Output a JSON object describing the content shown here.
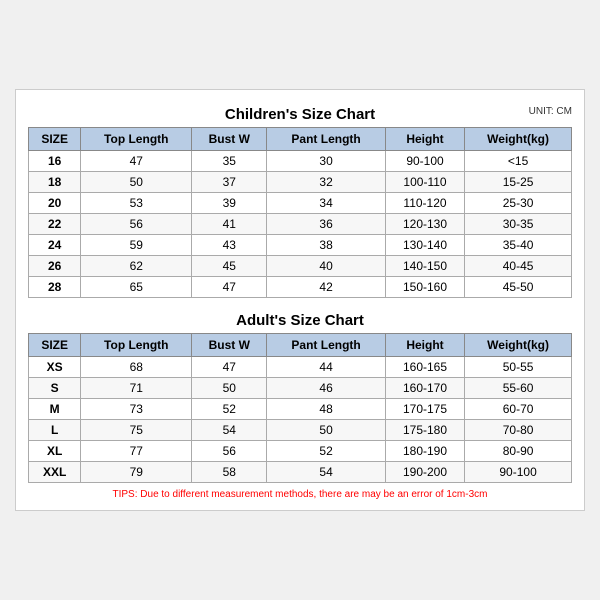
{
  "children_title": "Children's Size Chart",
  "adults_title": "Adult's Size Chart",
  "unit": "UNIT: CM",
  "headers": [
    "SIZE",
    "Top Length",
    "Bust W",
    "Pant Length",
    "Height",
    "Weight(kg)"
  ],
  "children_rows": [
    [
      "16",
      "47",
      "35",
      "30",
      "90-100",
      "<15"
    ],
    [
      "18",
      "50",
      "37",
      "32",
      "100-110",
      "15-25"
    ],
    [
      "20",
      "53",
      "39",
      "34",
      "110-120",
      "25-30"
    ],
    [
      "22",
      "56",
      "41",
      "36",
      "120-130",
      "30-35"
    ],
    [
      "24",
      "59",
      "43",
      "38",
      "130-140",
      "35-40"
    ],
    [
      "26",
      "62",
      "45",
      "40",
      "140-150",
      "40-45"
    ],
    [
      "28",
      "65",
      "47",
      "42",
      "150-160",
      "45-50"
    ]
  ],
  "adult_rows": [
    [
      "XS",
      "68",
      "47",
      "44",
      "160-165",
      "50-55"
    ],
    [
      "S",
      "71",
      "50",
      "46",
      "160-170",
      "55-60"
    ],
    [
      "M",
      "73",
      "52",
      "48",
      "170-175",
      "60-70"
    ],
    [
      "L",
      "75",
      "54",
      "50",
      "175-180",
      "70-80"
    ],
    [
      "XL",
      "77",
      "56",
      "52",
      "180-190",
      "80-90"
    ],
    [
      "XXL",
      "79",
      "58",
      "54",
      "190-200",
      "90-100"
    ]
  ],
  "tips": "TIPS: Due to different measurement methods, there are may be an error of 1cm-3cm"
}
